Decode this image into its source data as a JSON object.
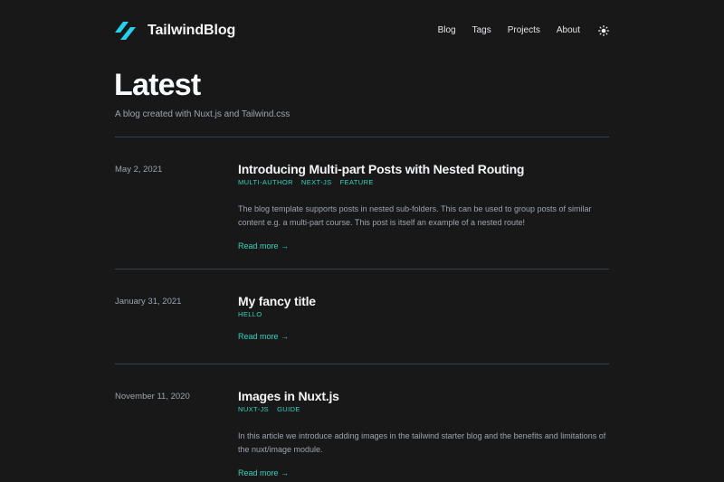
{
  "header": {
    "brand": "TailwindBlog",
    "nav": [
      "Blog",
      "Tags",
      "Projects",
      "About"
    ]
  },
  "hero": {
    "title": "Latest",
    "subtitle": "A blog created with Nuxt.js and Tailwind.css"
  },
  "posts": [
    {
      "date": "May 2, 2021",
      "title": "Introducing Multi-part Posts with Nested Routing",
      "tags": [
        "multi-author",
        "next-js",
        "feature"
      ],
      "summary": "The blog template supports posts in nested sub-folders. This can be used to group posts of similar content e.g. a multi-part course. This post is itself an example of a nested route!",
      "read_more": "Read more →"
    },
    {
      "date": "January 31, 2021",
      "title": "My fancy title",
      "tags": [
        "hello"
      ],
      "summary": "",
      "read_more": "Read more →"
    },
    {
      "date": "November 11, 2020",
      "title": "Images in Nuxt.js",
      "tags": [
        "nuxt-js",
        "guide"
      ],
      "summary": "In this article we introduce adding images in the tailwind starter blog and the benefits and limitations of the nuxt/image module.",
      "read_more": "Read more →"
    }
  ],
  "colors": {
    "background": "#181818",
    "accent": "#2dd4bf",
    "logo": "#22d3ee",
    "muted": "#9ca3af",
    "divider": "#374151"
  },
  "icons": {
    "logo": "tailwind-logo-icon",
    "theme": "sun-icon"
  }
}
